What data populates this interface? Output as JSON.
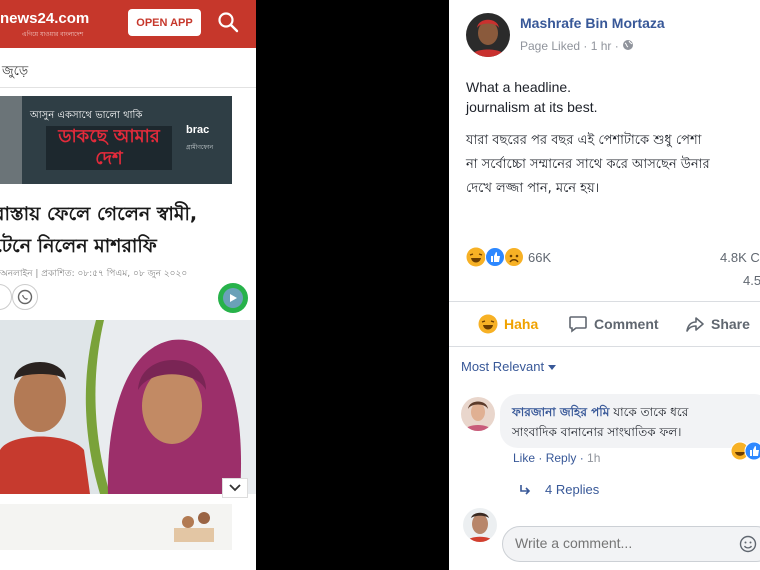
{
  "news": {
    "logo_text": "news24.com",
    "logo_tagline": "এগিয়ে যাওয়ার বাংলাদেশ",
    "open_app": "OPEN APP",
    "breadcrumb": "জুড়ে",
    "ad": {
      "slogan": "আসুন একসাথে ভালো থাকি",
      "headline": "ডাকছে আমার দেশ",
      "brand": "brac",
      "sponsor": "গ্রামীণফোন"
    },
    "headline_line1": "রাস্তায় ফেলে গেলেন স্বামী,",
    "headline_line2": "টেনে নিলেন মাশরাফি",
    "meta": "অনলাইন | প্রকাশিত: ০৮:৫৭ পিএম, ০৮ জুন ২০২০"
  },
  "post": {
    "author": "Mashrafe Bin Mortaza",
    "subtitle": "Page Liked · 1 hr ·",
    "text_line1": "What a headline.",
    "text_line2": "journalism at its best.",
    "bn_line1": "যারা বছরের পর বছর এই পেশাটাকে শুধু পেশা",
    "bn_line2": "না সর্বোচ্চো সম্মানের সাথে করে আসছেন উনার",
    "bn_line3": "দেখে লজ্জা পান, মনে হয়।",
    "reaction_count": "66K",
    "comments_count": "4.8K C",
    "shares_count": "4.5",
    "actions": {
      "haha": "Haha",
      "comment": "Comment",
      "share": "Share"
    },
    "sort_label": "Most Relevant",
    "comment": {
      "author": "ফারজানা জহির পমি",
      "text_line1": "যাকে তাকে ধরে",
      "text_line2": "সাংবাদিক বানানোর সাংঘাতিক ফল।",
      "like": "Like",
      "reply": "Reply",
      "time": "1h"
    },
    "replies_label": "4 Replies",
    "write_placeholder": "Write a comment..."
  },
  "colors": {
    "news_red": "#c6372b",
    "fb_link": "#385898",
    "haha": "#f7b125",
    "like": "#2d88ff"
  }
}
